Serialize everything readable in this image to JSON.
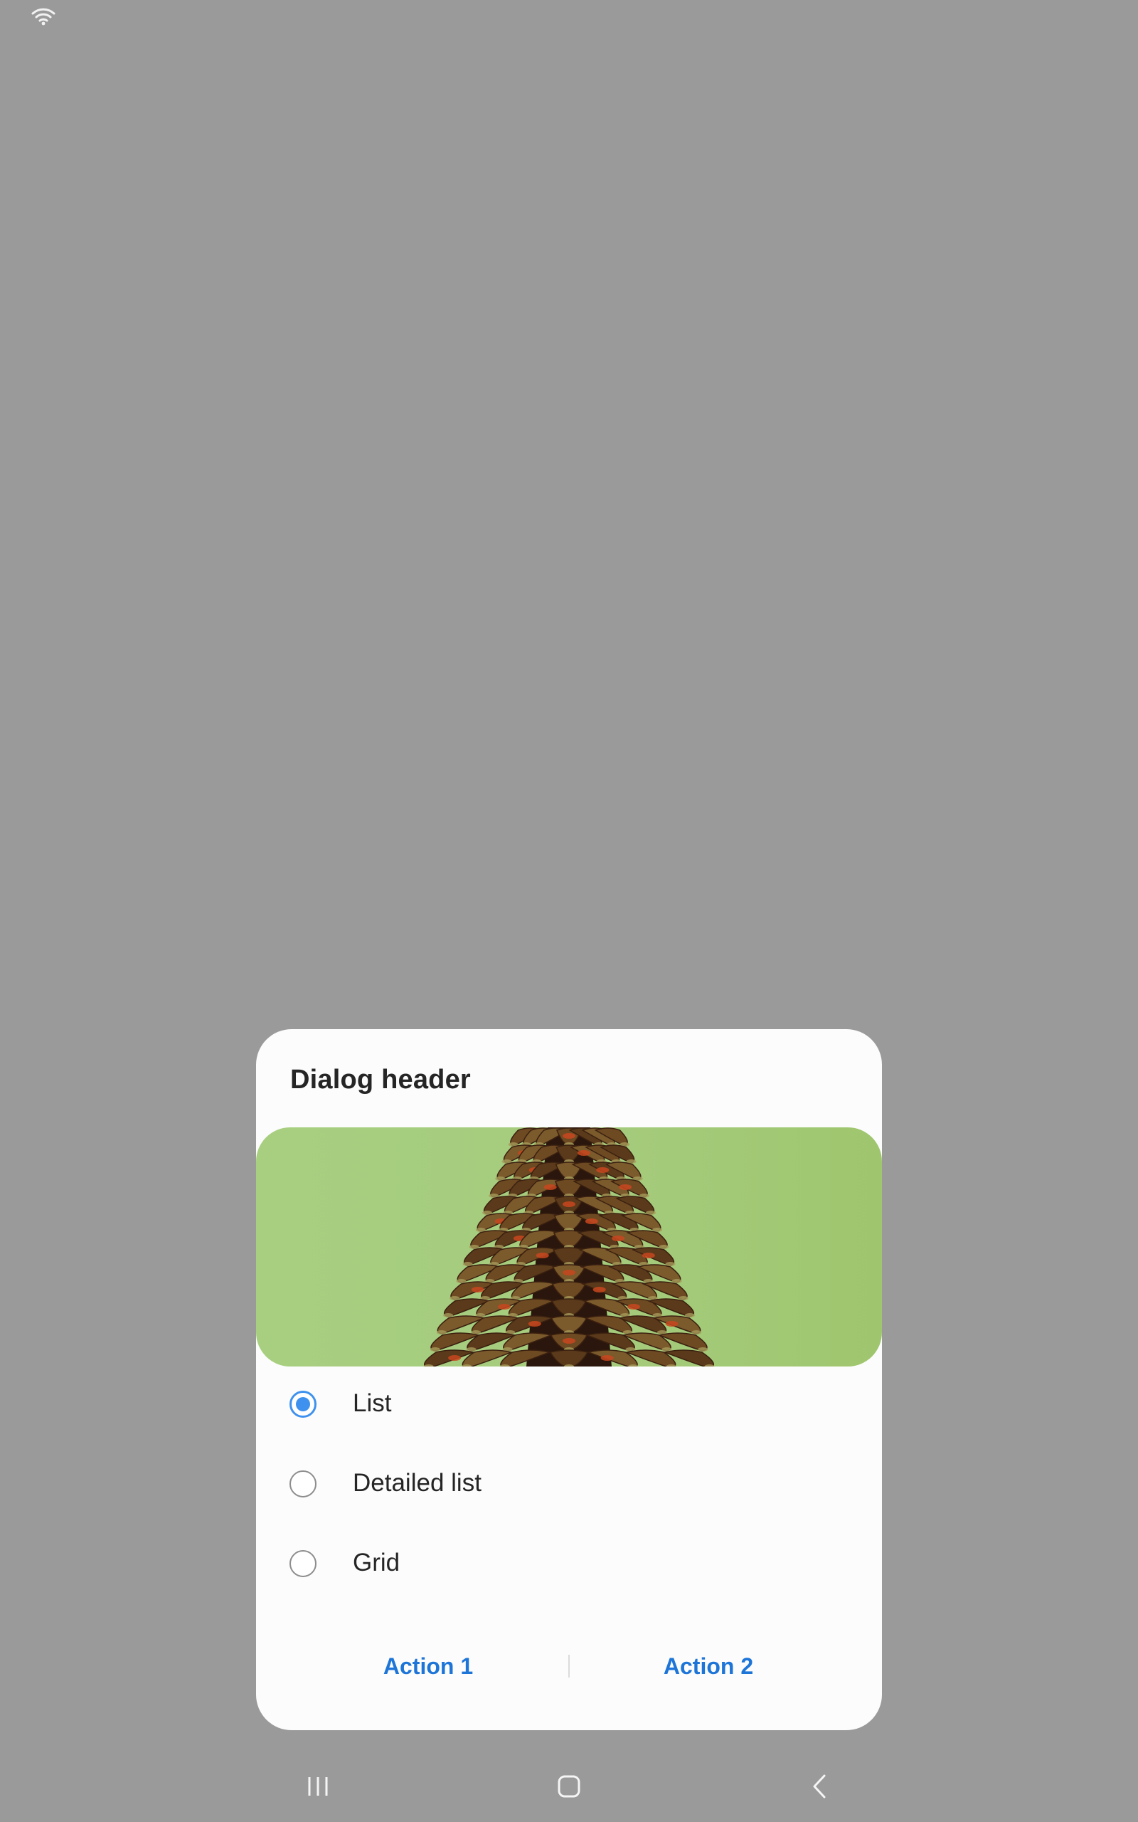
{
  "status_bar": {
    "wifi_icon": "wifi-icon"
  },
  "dialog": {
    "header": "Dialog header",
    "image_icon": "pinecone-photo",
    "options": [
      {
        "label": "List",
        "checked": true
      },
      {
        "label": "Detailed list",
        "checked": false
      },
      {
        "label": "Grid",
        "checked": false
      }
    ],
    "actions": {
      "action_1": "Action 1",
      "action_2": "Action 2"
    }
  },
  "nav_bar": {
    "recent_icon": "recent-apps-icon",
    "home_icon": "home-icon",
    "back_icon": "back-icon"
  },
  "colors": {
    "overlay": "#9a9a9a",
    "dialog_bg": "#fcfcfc",
    "accent": "#3e91ee",
    "action_text": "#1e75d8"
  }
}
